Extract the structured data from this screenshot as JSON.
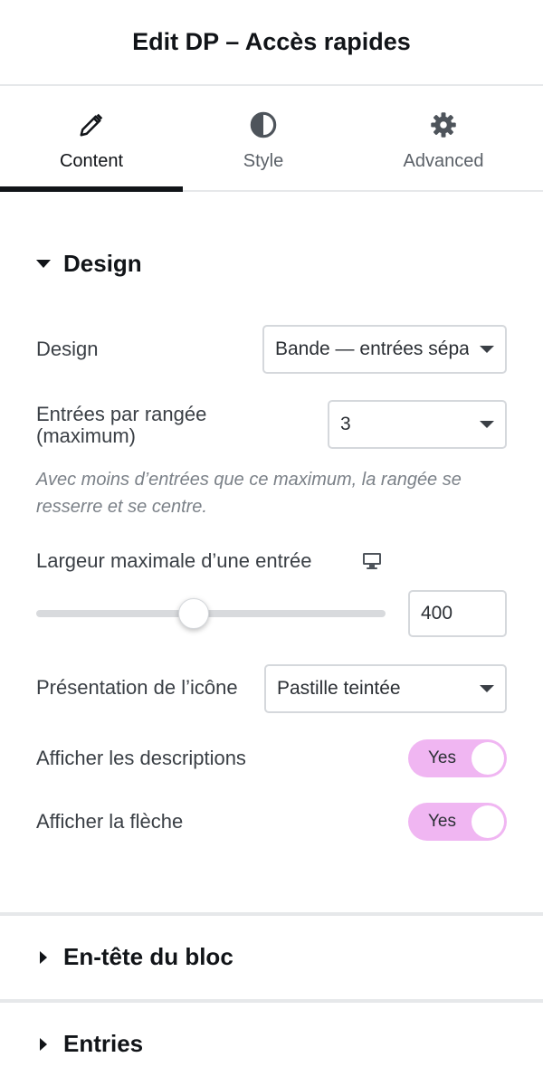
{
  "header": {
    "title": "Edit DP – Accès rapides"
  },
  "tabs": [
    {
      "label": "Content",
      "icon": "pencil-icon",
      "active": true
    },
    {
      "label": "Style",
      "icon": "contrast-icon",
      "active": false
    },
    {
      "label": "Advanced",
      "icon": "gear-icon",
      "active": false
    }
  ],
  "design_section": {
    "title": "Design",
    "design_label": "Design",
    "design_value": "Bande — entrées séparées",
    "entries_label_line1": "Entrées par rangée",
    "entries_label_line2": "(maximum)",
    "entries_value": "3",
    "note": "Avec moins d’entrées que ce maximum, la rangée se resserre et se centre.",
    "width_label": "Largeur maximale d’une entrée",
    "width_device_icon": "desktop-icon",
    "width_value": "400",
    "width_slider_fraction": 0.45,
    "icon_presentation_label": "Présentation de l’icône",
    "icon_presentation_value": "Pastille teintée",
    "show_descriptions_label": "Afficher les descriptions",
    "show_descriptions_state": "Yes",
    "show_arrow_label": "Afficher la flèche",
    "show_arrow_state": "Yes"
  },
  "collapsed_sections": [
    {
      "title": "En-tête du bloc"
    },
    {
      "title": "Entries"
    }
  ],
  "colors": {
    "accent_toggle": "#f0b6f2",
    "active_tab_bar": "#111418"
  }
}
